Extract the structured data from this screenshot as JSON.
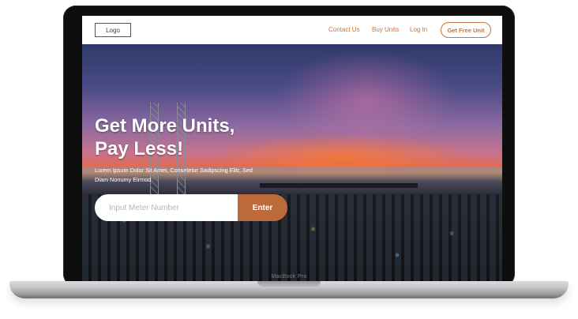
{
  "nav": {
    "logo": "Logo",
    "links": [
      "Contact Us",
      "Buy Units",
      "Log In"
    ],
    "cta": "Get Free Unit"
  },
  "hero": {
    "headline_line1": "Get More Units,",
    "headline_line2": "Pay Less!",
    "subtext_line1": "Lorem Ipsum Dolor Sit Amet, Consetetur Sadipscing Elitr, Sed",
    "subtext_line2": "Diam Nonumy Eirmod"
  },
  "search": {
    "placeholder": "Input Meter Number",
    "value": "",
    "button_label": "Enter"
  },
  "device": {
    "model_label": "MacBook Pro"
  },
  "colors": {
    "accent": "#c8743f",
    "button": "#bd6a3a",
    "nav_bg": "#ffffff",
    "bezel": "#0e0e0e"
  }
}
